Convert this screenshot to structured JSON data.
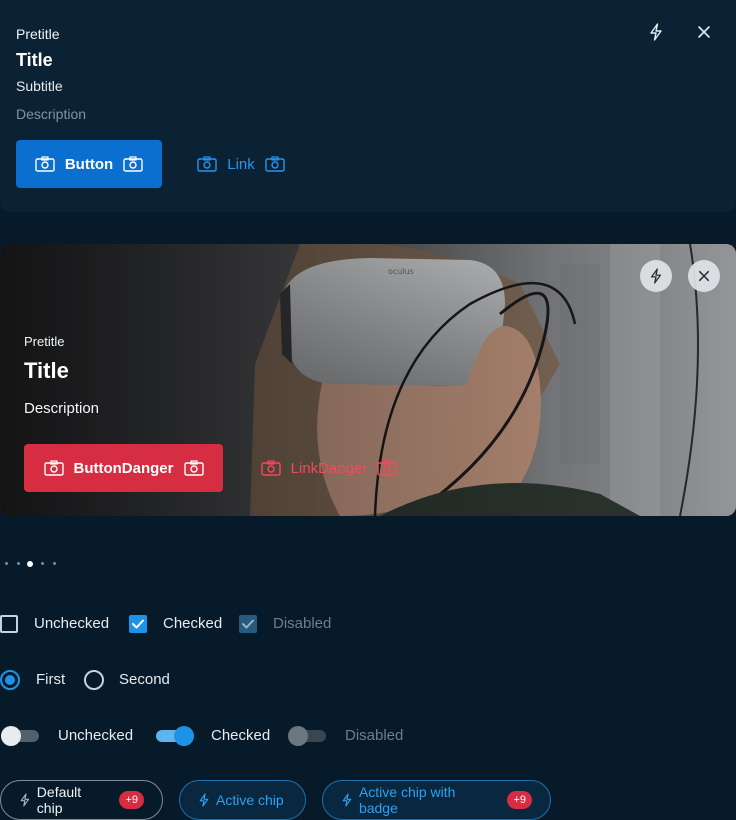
{
  "card1": {
    "pretitle": "Pretitle",
    "title": "Title",
    "subtitle": "Subtitle",
    "description": "Description",
    "primary_button": "Button",
    "link_button": "Link",
    "action_icon": "lightning-icon",
    "close_icon": "close-icon"
  },
  "card2": {
    "pretitle": "Pretitle",
    "title": "Title",
    "description": "Description",
    "danger_button": "ButtonDanger",
    "danger_link": "LinkDanger",
    "action_icon": "lightning-icon",
    "close_icon": "close-icon",
    "photo_text": "oculus"
  },
  "pagination": {
    "count": 5,
    "active": 2
  },
  "checkboxes": [
    {
      "label": "Unchecked",
      "state": "unchecked"
    },
    {
      "label": "Checked",
      "state": "checked"
    },
    {
      "label": "Disabled",
      "state": "disabled"
    }
  ],
  "radios": [
    {
      "label": "First",
      "checked": true
    },
    {
      "label": "Second",
      "checked": false
    }
  ],
  "toggles": [
    {
      "label": "Unchecked",
      "state": "off"
    },
    {
      "label": "Checked",
      "state": "on"
    },
    {
      "label": "Disabled",
      "state": "disabled"
    }
  ],
  "chips": [
    {
      "label": "Default chip",
      "badge": "+9",
      "variant": "default"
    },
    {
      "label": "Active chip",
      "badge": "",
      "variant": "active"
    },
    {
      "label": "Active chip with badge",
      "badge": "+9",
      "variant": "active"
    }
  ],
  "colors": {
    "background": "#071a29",
    "card": "#0b2234",
    "primary": "#0b6fd0",
    "link": "#2a95e8",
    "danger": "#d72d43",
    "accent": "#1e93e6"
  }
}
